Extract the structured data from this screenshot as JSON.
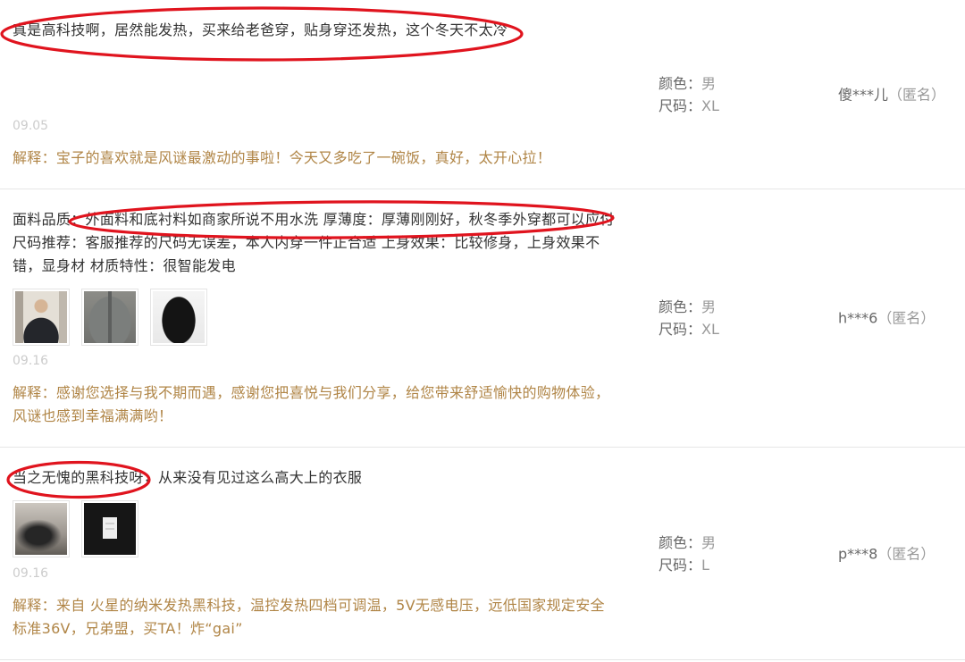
{
  "colors": {
    "reply": "#b08546",
    "highlight": "#e0141e"
  },
  "reviews": [
    {
      "content": "真是高科技啊，居然能发热，买来给老爸穿，贴身穿还发热，这个冬天不太冷",
      "date": "09.05",
      "reply": "解释：宝子的喜欢就是风谜最激动的事啦！今天又多吃了一碗饭，真好，太开心拉！",
      "sku": {
        "color_label": "颜色：",
        "color": "男",
        "size_label": "尺码：",
        "size": "XL"
      },
      "user": {
        "name": "傻***儿",
        "anon": "（匿名）"
      }
    },
    {
      "content": "面料品质：外面料和底衬料如商家所说不用水洗 厚薄度：厚薄刚刚好，秋冬季外穿都可以应付 尺码推荐：客服推荐的尺码无误差，本人内穿一件正合适 上身效果：比较修身，上身效果不错，显身材 材质特性：很智能发电",
      "date": "09.16",
      "reply": "解释：感谢您选择与我不期而遇，感谢您把喜悦与我们分享，给您带来舒适愉快的购物体验，风谜也感到幸福满满哟！",
      "sku": {
        "color_label": "颜色：",
        "color": "男",
        "size_label": "尺码：",
        "size": "XL"
      },
      "user": {
        "name": "h***6",
        "anon": "（匿名）"
      }
    },
    {
      "content": "当之无愧的黑科技呀，从来没有见过这么高大上的衣服",
      "date": "09.16",
      "reply": "解释：来自 火星的纳米发热黑科技，温控发热四档可调温，5V无感电压，远低国家规定安全标准36V，兄弟盟，买TA！炸“gai”",
      "sku": {
        "color_label": "颜色：",
        "color": "男",
        "size_label": "尺码：",
        "size": "L"
      },
      "user": {
        "name": "p***8",
        "anon": "（匿名）"
      }
    }
  ]
}
